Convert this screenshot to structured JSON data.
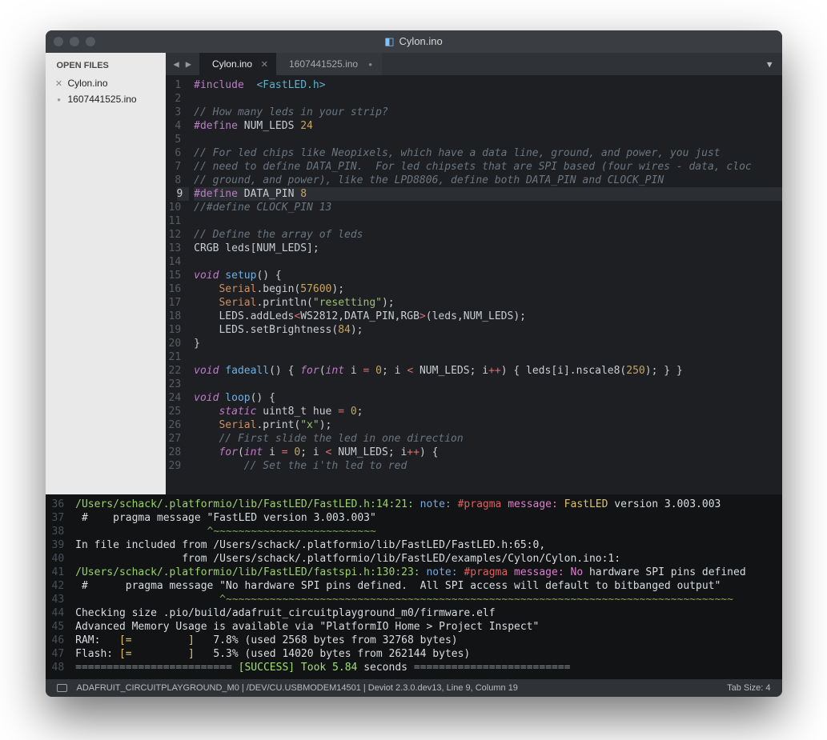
{
  "window": {
    "title": "Cylon.ino"
  },
  "sidebar": {
    "header": "OPEN FILES",
    "items": [
      {
        "label": "Cylon.ino",
        "marker": "close"
      },
      {
        "label": "1607441525.ino",
        "marker": "bullet"
      }
    ]
  },
  "tabs": {
    "active": {
      "label": "Cylon.ino"
    },
    "inactive": {
      "label": "1607441525.ino"
    }
  },
  "code": {
    "lines": [
      {
        "n": 1,
        "html": "<span class='pp'>#include</span>  <span class='an'>&lt;FastLED.h&gt;</span>"
      },
      {
        "n": 2,
        "html": ""
      },
      {
        "n": 3,
        "html": "<span class='cm'>// How many leds in your strip?</span>"
      },
      {
        "n": 4,
        "html": "<span class='pp'>#define</span> <span class='id'>NUM_LEDS</span> <span class='nm'>24</span>"
      },
      {
        "n": 5,
        "html": ""
      },
      {
        "n": 6,
        "html": "<span class='cm'>// For led chips like Neopixels, which have a data line, ground, and power, you just</span>"
      },
      {
        "n": 7,
        "html": "<span class='cm'>// need to define DATA_PIN.  For led chipsets that are SPI based (four wires - data, cloc</span>"
      },
      {
        "n": 8,
        "html": "<span class='cm'>// ground, and power), like the LPD8806, define both DATA_PIN and CLOCK_PIN</span>"
      },
      {
        "n": 9,
        "hl": true,
        "html": "<span class='pp'>#define</span> <span class='id'>DATA_PIN</span> <span class='nm'>8</span>"
      },
      {
        "n": 10,
        "html": "<span class='cm'>//#define CLOCK_PIN 13</span>"
      },
      {
        "n": 11,
        "html": ""
      },
      {
        "n": 12,
        "html": "<span class='cm'>// Define the array of leds</span>"
      },
      {
        "n": 13,
        "html": "<span class='id'>CRGB leds[NUM_LEDS];</span>"
      },
      {
        "n": 14,
        "html": ""
      },
      {
        "n": 15,
        "html": "<span class='kw'>void</span> <span class='fn'>setup</span><span class='id'>() {</span>"
      },
      {
        "n": 16,
        "html": "    <span class='obj'>Serial</span><span class='id'>.begin(</span><span class='nm'>57600</span><span class='id'>);</span>"
      },
      {
        "n": 17,
        "html": "    <span class='obj'>Serial</span><span class='id'>.println(</span><span class='st'>\"resetting\"</span><span class='id'>);</span>"
      },
      {
        "n": 18,
        "html": "    <span class='id'>LEDS.addLeds</span><span class='op'>&lt;</span><span class='id'>WS2812,DATA_PIN,RGB</span><span class='op'>&gt;</span><span class='id'>(leds,NUM_LEDS);</span>"
      },
      {
        "n": 19,
        "html": "    <span class='id'>LEDS.setBrightness(</span><span class='nm'>84</span><span class='id'>);</span>"
      },
      {
        "n": 20,
        "html": "<span class='id'>}</span>"
      },
      {
        "n": 21,
        "html": ""
      },
      {
        "n": 22,
        "html": "<span class='kw'>void</span> <span class='fn'>fadeall</span><span class='id'>() { </span><span class='kw'>for</span><span class='id'>(</span><span class='kw'>int</span><span class='id'> i </span><span class='op'>=</span><span class='id'> </span><span class='nm'>0</span><span class='id'>; i </span><span class='op'>&lt;</span><span class='id'> NUM_LEDS; i</span><span class='op'>++</span><span class='id'>) { leds[i].nscale8(</span><span class='nm'>250</span><span class='id'>); } }</span>"
      },
      {
        "n": 23,
        "html": ""
      },
      {
        "n": 24,
        "html": "<span class='kw'>void</span> <span class='fn'>loop</span><span class='id'>() {</span>"
      },
      {
        "n": 25,
        "html": "    <span class='kw'>static</span> <span class='id'>uint8_t hue </span><span class='op'>=</span><span class='id'> </span><span class='nm'>0</span><span class='id'>;</span>"
      },
      {
        "n": 26,
        "html": "    <span class='obj'>Serial</span><span class='id'>.print(</span><span class='st'>\"x\"</span><span class='id'>);</span>"
      },
      {
        "n": 27,
        "html": "    <span class='cm'>// First slide the led in one direction</span>"
      },
      {
        "n": 28,
        "html": "    <span class='kw'>for</span><span class='id'>(</span><span class='kw'>int</span><span class='id'> i </span><span class='op'>=</span><span class='id'> </span><span class='nm'>0</span><span class='id'>; i </span><span class='op'>&lt;</span><span class='id'> NUM_LEDS; i</span><span class='op'>++</span><span class='id'>) {</span>"
      },
      {
        "n": 29,
        "html": "        <span class='cm'>// Set the i'th led to red</span>"
      }
    ]
  },
  "console": {
    "rows": [
      {
        "n": 36,
        "html": "<span class='c-path'>/Users/schack/.platformio/lib/FastLED/FastLED.h:14:21:</span> <span class='c-note'>note:</span> <span class='c-pragma'>#pragma</span> <span class='c-msgkw'>message:</span> <span class='c-fast'>FastLED</span> version 3.003.003"
      },
      {
        "n": 37,
        "html": " #    pragma message \"FastLED version 3.003.003\""
      },
      {
        "n": 38,
        "html": "                     <span class='c-caret'>^~~~~~~~~~~~~~~~~~~~~~~~~~~</span>"
      },
      {
        "n": 39,
        "html": "In file included from /Users/schack/.platformio/lib/FastLED/FastLED.h:65:0,"
      },
      {
        "n": 40,
        "html": "                 from /Users/schack/.platformio/lib/FastLED/examples/Cylon/Cylon.ino:1:"
      },
      {
        "n": 41,
        "html": "<span class='c-path'>/Users/schack/.platformio/lib/FastLED/fastspi.h:130:23:</span> <span class='c-note'>note:</span> <span class='c-pragma'>#pragma</span> <span class='c-msgkw'>message:</span> <span class='c-no'>No</span> hardware SPI pins defined"
      },
      {
        "n": 42,
        "html": " #      pragma message \"No hardware SPI pins defined.  All SPI access will default to bitbanged output\""
      },
      {
        "n": 43,
        "html": "                       <span class='c-caret'>^~~~~~~~~~~~~~~~~~~~~~~~~~~~~~~~~~~~~~~~~~~~~~~~~~~~~~~~~~~~~~~~~~~~~~~~~~~~~~~~~~</span>"
      },
      {
        "n": 44,
        "html": "Checking size .pio/build/adafruit_circuitplayground_m0/firmware.elf"
      },
      {
        "n": 45,
        "html": "Advanced Memory Usage is available via \"PlatformIO Home &gt; Project Inspect\""
      },
      {
        "n": 46,
        "html": "RAM:   <span class='c-brkt'>[=         ]</span>   7.8% (used 2568 bytes from 32768 bytes)"
      },
      {
        "n": 47,
        "html": "Flash: <span class='c-brkt'>[=         ]</span>   5.3% (used 14020 bytes from 262144 bytes)"
      },
      {
        "n": 48,
        "html": "<span class='c-eq'>=========================</span> <span class='c-succ'>[SUCCESS] Took 5.84</span> seconds <span class='c-eq'>=========================</span>"
      }
    ]
  },
  "status": {
    "left": "ADAFRUIT_CIRCUITPLAYGROUND_M0 | /DEV/CU.USBMODEM14501 | Deviot 2.3.0.dev13, Line 9, Column 19",
    "right": "Tab Size: 4"
  }
}
